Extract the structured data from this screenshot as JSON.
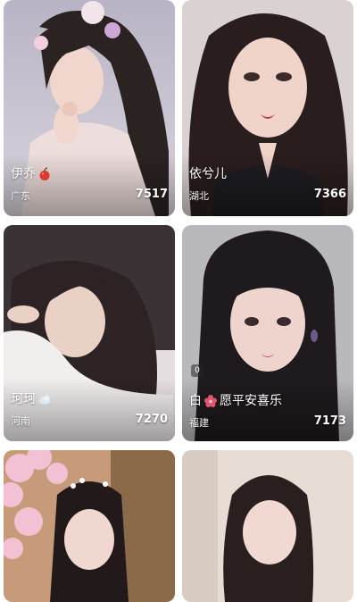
{
  "cards": [
    {
      "name": "伊乔",
      "emoji": "apple-icon",
      "region": "广东",
      "count": "7517"
    },
    {
      "name": "依兮儿",
      "emoji": "",
      "region": "湖北",
      "count": "7366"
    },
    {
      "name": "珂珂",
      "emoji": "cloud-icon",
      "region": "河南",
      "count": "7270"
    },
    {
      "name_prefix": "白",
      "name": "愿平安喜乐",
      "emoji": "flower-icon",
      "region": "福建",
      "count": "7173",
      "badge": "0"
    },
    {
      "name": "",
      "region": "",
      "count": ""
    },
    {
      "name": "",
      "region": "",
      "count": ""
    }
  ],
  "colors": {
    "apple": "#d93a2b",
    "flower": "#e0566c",
    "cloud": "#dfe9f2"
  }
}
